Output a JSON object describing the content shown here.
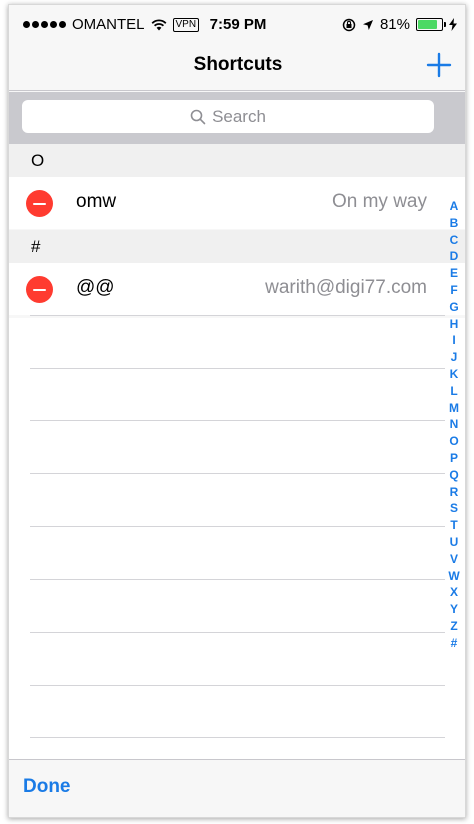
{
  "status_bar": {
    "carrier": "OMANTEL",
    "vpn": "VPN",
    "time": "7:59 PM",
    "battery_percent": "81%",
    "battery_level": 0.81,
    "battery_color": "#4cd964"
  },
  "navbar": {
    "title": "Shortcuts",
    "add_icon": "plus-icon"
  },
  "search": {
    "placeholder": "Search",
    "icon": "search-icon"
  },
  "sections": [
    {
      "header": "O",
      "rows": [
        {
          "phrase": "omw",
          "expansion": "On my way"
        }
      ]
    },
    {
      "header": "#",
      "rows": [
        {
          "phrase": "@@",
          "expansion": "warith@digi77.com"
        }
      ]
    }
  ],
  "index_letters": [
    "A",
    "B",
    "C",
    "D",
    "E",
    "F",
    "G",
    "H",
    "I",
    "J",
    "K",
    "L",
    "M",
    "N",
    "O",
    "P",
    "Q",
    "R",
    "S",
    "T",
    "U",
    "V",
    "W",
    "X",
    "Y",
    "Z",
    "#"
  ],
  "toolbar": {
    "done_label": "Done"
  },
  "colors": {
    "accent": "#1a7be6",
    "delete": "#ff3b30"
  }
}
